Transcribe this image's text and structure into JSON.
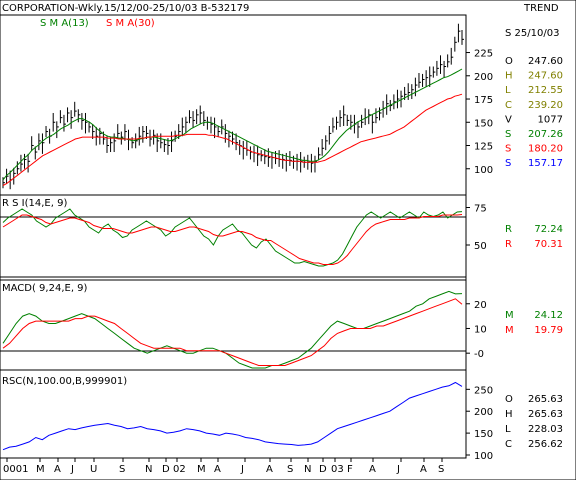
{
  "header": {
    "title": "CORPORATION-Wkly.15/12/00-25/10/03  B-532179",
    "trend_label": "TREND"
  },
  "colors": {
    "background": "#ffffff",
    "axis": "#000000",
    "price_bars": "#000000",
    "sma13": "#008000",
    "sma30": "#ff0000",
    "rsc_line": "#0000ff",
    "green_text": "#008000",
    "red_text": "#ff0000",
    "blue_text": "#0000ff",
    "olive_text": "#808000"
  },
  "chart_data": [
    {
      "type": "line",
      "name": "price-panel",
      "title": "",
      "legend": [
        {
          "label": "S M A(13)",
          "color": "#008000"
        },
        {
          "label": "S M A(30)",
          "color": "#ff0000"
        }
      ],
      "ylim": [
        75,
        260
      ],
      "y_ticks": [
        "225",
        "200",
        "175",
        "150",
        "125",
        "100"
      ],
      "series": [
        {
          "name": "S M A(13)",
          "values": [
            88,
            93,
            96,
            100,
            104,
            108,
            112,
            115,
            120,
            123,
            126,
            130,
            133,
            135,
            137,
            140,
            143,
            145,
            147,
            150,
            152,
            154,
            154,
            152,
            150,
            147,
            143,
            140,
            137,
            135,
            134,
            134,
            133,
            133,
            132,
            131,
            130,
            131,
            132,
            133,
            134,
            134,
            134,
            133,
            132,
            131,
            130,
            131,
            133,
            135,
            137,
            140,
            143,
            145,
            147,
            149,
            150,
            150,
            149,
            147,
            145,
            143,
            141,
            139,
            137,
            135,
            133,
            131,
            129,
            127,
            125,
            123,
            121,
            119,
            118,
            117,
            116,
            115,
            114,
            113,
            112,
            111,
            110,
            109,
            109,
            108,
            108,
            109,
            111,
            114,
            118,
            123,
            128,
            133,
            137,
            141,
            144,
            147,
            150,
            152,
            154,
            156,
            158,
            160,
            162,
            164,
            166,
            168,
            170,
            172,
            174,
            176,
            178,
            180,
            182,
            184,
            186,
            188,
            190,
            192,
            194,
            196,
            198,
            199,
            201,
            203,
            205,
            207.26
          ]
        },
        {
          "name": "S M A(30)",
          "values": [
            82,
            84,
            87,
            90,
            93,
            96,
            99,
            102,
            105,
            108,
            111,
            114,
            116,
            118,
            120,
            122,
            124,
            126,
            128,
            130,
            132,
            133,
            134,
            134,
            134,
            134,
            134,
            134,
            134,
            133,
            133,
            133,
            132,
            132,
            132,
            132,
            132,
            132,
            133,
            133,
            134,
            134,
            135,
            135,
            135,
            135,
            135,
            135,
            136,
            136,
            136,
            137,
            137,
            137,
            137,
            137,
            137,
            136,
            136,
            135,
            134,
            133,
            132,
            130,
            128,
            126,
            124,
            122,
            120,
            118,
            117,
            116,
            115,
            114,
            113,
            112,
            111,
            110,
            109,
            109,
            108,
            108,
            108,
            107,
            107,
            107,
            107,
            107,
            108,
            109,
            111,
            113,
            115,
            117,
            119,
            121,
            123,
            125,
            127,
            129,
            130,
            131,
            132,
            133,
            134,
            135,
            136,
            137,
            139,
            141,
            143,
            145,
            148,
            151,
            154,
            157,
            160,
            163,
            165,
            167,
            169,
            171,
            173,
            175,
            176,
            178,
            179,
            180.2
          ]
        },
        {
          "name": "price-close",
          "values": [
            85,
            92,
            88,
            95,
            100,
            105,
            110,
            108,
            125,
            118,
            130,
            128,
            140,
            135,
            150,
            145,
            155,
            148,
            160,
            155,
            162,
            158,
            152,
            150,
            145,
            140,
            135,
            138,
            132,
            125,
            128,
            130,
            138,
            134,
            140,
            132,
            128,
            130,
            135,
            140,
            138,
            132,
            136,
            130,
            128,
            126,
            125,
            130,
            135,
            140,
            145,
            150,
            155,
            152,
            158,
            160,
            152,
            150,
            148,
            145,
            140,
            145,
            138,
            135,
            132,
            128,
            125,
            122,
            120,
            118,
            117,
            115,
            114,
            113,
            112,
            112,
            111,
            110,
            110,
            109,
            109,
            108,
            108,
            108,
            107,
            107,
            106,
            108,
            115,
            122,
            130,
            138,
            145,
            150,
            155,
            158,
            152,
            150,
            148,
            145,
            150,
            155,
            158,
            150,
            155,
            160,
            165,
            170,
            168,
            172,
            175,
            178,
            180,
            182,
            185,
            190,
            193,
            196,
            198,
            200,
            204,
            208,
            212,
            210,
            215,
            220,
            236,
            248,
            239.2
          ]
        }
      ]
    },
    {
      "type": "line",
      "name": "rsi-panel",
      "title": "R S I(14,E, 9)",
      "ylim": [
        28,
        80
      ],
      "y_ticks": [
        "75",
        "50"
      ],
      "series": [
        {
          "name": "rsi",
          "values": [
            65,
            68,
            70,
            72,
            74,
            72,
            70,
            66,
            64,
            62,
            64,
            68,
            70,
            72,
            74,
            70,
            68,
            66,
            62,
            60,
            58,
            62,
            64,
            60,
            58,
            55,
            56,
            60,
            62,
            64,
            66,
            64,
            62,
            60,
            56,
            58,
            62,
            64,
            66,
            68,
            64,
            60,
            56,
            54,
            50,
            56,
            60,
            62,
            64,
            60,
            58,
            54,
            50,
            48,
            52,
            54,
            50,
            46,
            44,
            42,
            40,
            38,
            38,
            39,
            38,
            37,
            36,
            36,
            37,
            38,
            40,
            44,
            50,
            56,
            62,
            66,
            70,
            72,
            70,
            68,
            70,
            72,
            70,
            68,
            70,
            72,
            70,
            68,
            72,
            70,
            69,
            70,
            72,
            68,
            70,
            72,
            72.24
          ]
        },
        {
          "name": "signal",
          "values": [
            62,
            64,
            66,
            68,
            70,
            70,
            69,
            68,
            67,
            65,
            64,
            65,
            66,
            67,
            68,
            68,
            67,
            66,
            65,
            63,
            62,
            61,
            61,
            61,
            60,
            59,
            58,
            58,
            59,
            60,
            61,
            62,
            62,
            61,
            60,
            59,
            59,
            60,
            61,
            62,
            62,
            61,
            60,
            59,
            57,
            56,
            56,
            57,
            58,
            59,
            59,
            58,
            57,
            55,
            54,
            53,
            53,
            51,
            49,
            47,
            45,
            43,
            41,
            40,
            39,
            38,
            38,
            37,
            37,
            37,
            38,
            40,
            43,
            47,
            51,
            55,
            59,
            62,
            64,
            65,
            66,
            67,
            67,
            67,
            67,
            68,
            68,
            68,
            69,
            69,
            69,
            69,
            70,
            70,
            70,
            70,
            70.31
          ]
        }
      ]
    },
    {
      "type": "line",
      "name": "macd-panel",
      "title": "MACD( 9,24,E, 9)",
      "ylim": [
        -6,
        28
      ],
      "y_ticks": [
        "20",
        "10",
        "-0"
      ],
      "series": [
        {
          "name": "macd",
          "values": [
            4,
            8,
            12,
            15,
            16,
            15,
            13,
            12,
            12,
            13,
            14,
            15,
            16,
            15,
            14,
            12,
            10,
            8,
            6,
            4,
            2,
            1,
            0,
            1,
            2,
            3,
            2,
            1,
            0,
            0,
            1,
            2,
            2,
            1,
            0,
            -2,
            -4,
            -5,
            -6,
            -6,
            -6,
            -5,
            -5,
            -4,
            -3,
            -2,
            0,
            2,
            5,
            8,
            11,
            13,
            12,
            11,
            10,
            10,
            11,
            12,
            13,
            14,
            15,
            16,
            17,
            19,
            20,
            22,
            23,
            24,
            25,
            24,
            24.12
          ]
        },
        {
          "name": "signal",
          "values": [
            2,
            4,
            7,
            10,
            12,
            13,
            13,
            13,
            13,
            13,
            13,
            14,
            14,
            15,
            15,
            14,
            13,
            12,
            10,
            8,
            6,
            4,
            3,
            2,
            2,
            2,
            2,
            2,
            1,
            1,
            1,
            1,
            1,
            1,
            0,
            -1,
            -2,
            -3,
            -4,
            -5,
            -5,
            -5,
            -5,
            -5,
            -4,
            -3,
            -2,
            -1,
            1,
            3,
            6,
            8,
            9,
            10,
            10,
            10,
            10,
            11,
            11,
            12,
            13,
            14,
            15,
            16,
            17,
            18,
            19,
            20,
            21,
            22,
            19.79
          ]
        }
      ]
    },
    {
      "type": "line",
      "name": "rsc-panel",
      "title": "RSC(N,100.00,B,999901)",
      "ylim": [
        100,
        285
      ],
      "y_ticks": [
        "250",
        "200",
        "150",
        "100"
      ],
      "series": [
        {
          "name": "rsc",
          "values": [
            112,
            118,
            120,
            125,
            130,
            140,
            135,
            145,
            150,
            155,
            160,
            158,
            162,
            165,
            168,
            170,
            172,
            168,
            165,
            160,
            162,
            165,
            160,
            158,
            155,
            150,
            152,
            155,
            160,
            158,
            155,
            150,
            148,
            145,
            150,
            148,
            145,
            140,
            138,
            135,
            130,
            128,
            126,
            125,
            124,
            122,
            123,
            125,
            130,
            140,
            150,
            160,
            165,
            170,
            175,
            180,
            185,
            190,
            195,
            200,
            210,
            220,
            230,
            235,
            240,
            245,
            250,
            255,
            258,
            265.63,
            256.62
          ]
        }
      ]
    }
  ],
  "x_axis_labels": [
    "0001",
    "M",
    "A",
    "J",
    "U",
    "S",
    "N",
    "D",
    "02",
    "M",
    "A",
    "J",
    "A",
    "S",
    "N",
    "D",
    "03",
    "F",
    "A",
    "J",
    "A",
    "S"
  ],
  "price_readout": {
    "date": "S 25/10/03",
    "rows": [
      {
        "label": "O",
        "value": "247.60",
        "color": "#000000"
      },
      {
        "label": "H",
        "value": "247.60",
        "color": "#808000"
      },
      {
        "label": "L",
        "value": "212.55",
        "color": "#808000"
      },
      {
        "label": "C",
        "value": "239.20",
        "color": "#808000"
      },
      {
        "label": "V",
        "value": "1077",
        "color": "#000000"
      },
      {
        "label": "S",
        "value": "207.26",
        "color": "#008000"
      },
      {
        "label": "S",
        "value": "180.20",
        "color": "#ff0000"
      },
      {
        "label": "S",
        "value": "157.17",
        "color": "#0000ff"
      }
    ]
  },
  "rsi_readout": [
    {
      "label": "R",
      "value": "72.24",
      "color": "#008000"
    },
    {
      "label": "R",
      "value": "70.31",
      "color": "#ff0000"
    }
  ],
  "macd_readout": [
    {
      "label": "M",
      "value": "24.12",
      "color": "#008000"
    },
    {
      "label": "M",
      "value": "19.79",
      "color": "#ff0000"
    }
  ],
  "rsc_readout": [
    {
      "label": "O",
      "value": "265.63",
      "color": "#000000"
    },
    {
      "label": "H",
      "value": "265.63",
      "color": "#000000"
    },
    {
      "label": "L",
      "value": "228.03",
      "color": "#000000"
    },
    {
      "label": "C",
      "value": "256.62",
      "color": "#000000"
    }
  ]
}
